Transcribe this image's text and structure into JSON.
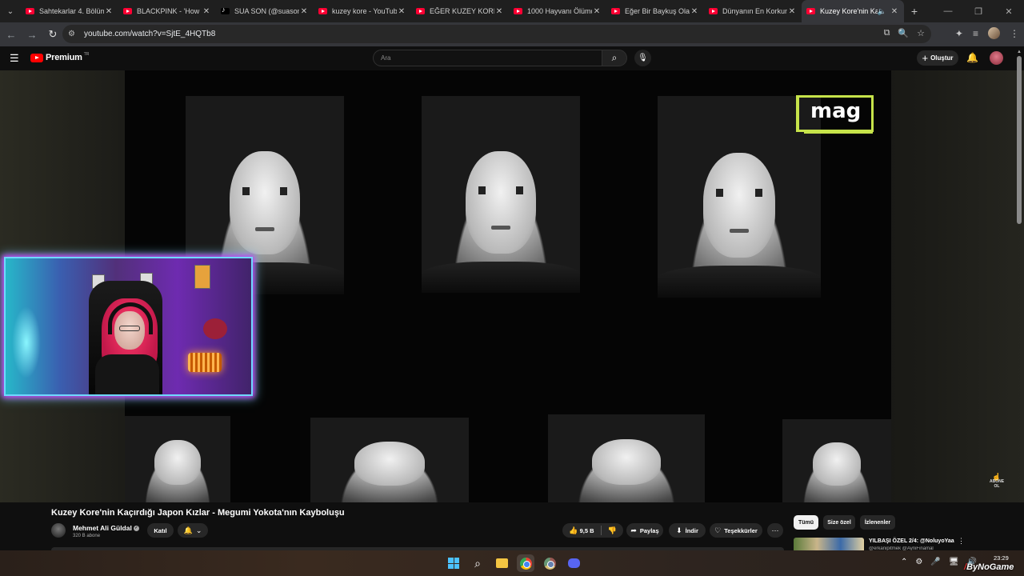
{
  "browser": {
    "tabs": [
      {
        "title": "Sahtekarlar 4. Bölüm",
        "favicon": "youtube-icon"
      },
      {
        "title": "BLACKPINK - 'How You",
        "favicon": "youtube-icon"
      },
      {
        "title": "SUA SON (@suasonk",
        "favicon": "tiktok-icon"
      },
      {
        "title": "kuzey kore - YouTube",
        "favicon": "youtube-icon"
      },
      {
        "title": "EĞER KUZEY KORE'DE",
        "favicon": "youtube-icon"
      },
      {
        "title": "1000 Hayvanı Ölümd",
        "favicon": "youtube-icon"
      },
      {
        "title": "Eğer Bir Baykuş Olar",
        "favicon": "youtube-icon"
      },
      {
        "title": "Dünyanın En Korkunç",
        "favicon": "youtube-icon"
      },
      {
        "title": "Kuzey Kore'nin Ka",
        "favicon": "youtube-icon",
        "active": true
      }
    ],
    "url": "youtube.com/watch?v=SjtE_4HQTb8"
  },
  "youtube": {
    "brand": "Premium",
    "country": "TR",
    "search_placeholder": "Ara",
    "create_label": "Oluştur"
  },
  "video": {
    "overlay_text": "mag",
    "subscribe_watermark": [
      "ABONE",
      "OL"
    ],
    "title": "Kuzey Kore'nin Kaçırdığı Japon Kızlar - Megumi Yokota'nın Kayboluşu",
    "channel": "Mehmet Ali Güldal",
    "subscribers": "320 B abone",
    "join_label": "Katıl",
    "likes": "9,5 B",
    "share_label": "Paylaş",
    "download_label": "İndir",
    "thanks_label": "Teşekkürler"
  },
  "sidebar": {
    "chips": [
      "Tümü",
      "Size özel",
      "İzlenenler"
    ],
    "selected_chip": 0,
    "recommendation": {
      "title": "YILBAŞI ÖZEL 2/4: @NoluyoYaa",
      "subtitle": "@erkanipitmek @AyniFinamal"
    }
  },
  "taskbar": {
    "time": "23:29",
    "apps": [
      "start-icon",
      "search-icon",
      "file-explorer-icon",
      "chrome-icon",
      "chrome-profile-icon",
      "discord-icon"
    ]
  },
  "watermark": {
    "text": "ByNoGame"
  },
  "colors": {
    "youtube_red": "#ff0000",
    "webcam_border": "#6fd9ff",
    "webcam_glow": "#c03cf0",
    "overlay_accent": "#c6e34a"
  }
}
